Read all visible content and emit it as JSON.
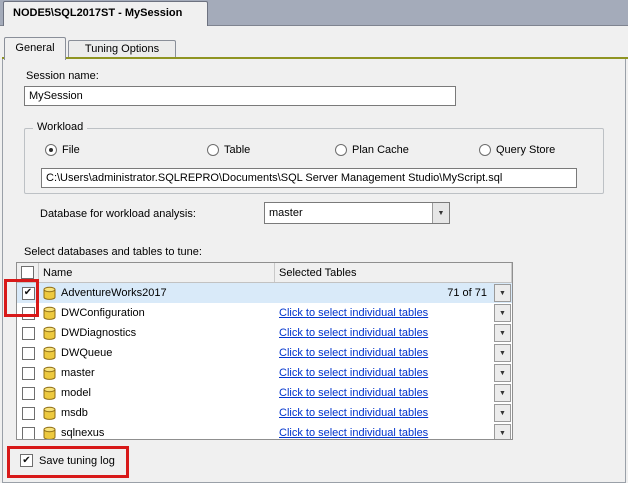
{
  "window": {
    "document_tab_label": "NODE5\\SQL2017ST - MySession"
  },
  "tabs": {
    "general": "General",
    "tuning_options": "Tuning Options"
  },
  "general_tab": {
    "session_name_label": "Session name:",
    "session_name_value": "MySession",
    "workload": {
      "group_label": "Workload",
      "options": [
        {
          "label": "File",
          "selected": true
        },
        {
          "label": "Table",
          "selected": false
        },
        {
          "label": "Plan Cache",
          "selected": false
        },
        {
          "label": "Query Store",
          "selected": false
        }
      ],
      "file_path": "C:\\Users\\administrator.SQLREPRO\\Documents\\SQL Server Management Studio\\MyScript.sql",
      "database_for_analysis_label": "Database for workload analysis:",
      "database_for_analysis_value": "master"
    },
    "databases_section": {
      "label": "Select databases and tables to tune:",
      "columns": {
        "name": "Name",
        "selected_tables": "Selected Tables"
      },
      "header_checkbox_checked": false,
      "rows": [
        {
          "name": "AdventureWorks2017",
          "checked": true,
          "selected_tables_text": "71 of 71",
          "is_link": false,
          "highlighted": true
        },
        {
          "name": "DWConfiguration",
          "checked": false,
          "selected_tables_text": "Click to select individual tables",
          "is_link": true,
          "highlighted": false
        },
        {
          "name": "DWDiagnostics",
          "checked": false,
          "selected_tables_text": "Click to select individual tables",
          "is_link": true,
          "highlighted": false
        },
        {
          "name": "DWQueue",
          "checked": false,
          "selected_tables_text": "Click to select individual tables",
          "is_link": true,
          "highlighted": false
        },
        {
          "name": "master",
          "checked": false,
          "selected_tables_text": "Click to select individual tables",
          "is_link": true,
          "highlighted": false
        },
        {
          "name": "model",
          "checked": false,
          "selected_tables_text": "Click to select individual tables",
          "is_link": true,
          "highlighted": false
        },
        {
          "name": "msdb",
          "checked": false,
          "selected_tables_text": "Click to select individual tables",
          "is_link": true,
          "highlighted": false
        },
        {
          "name": "sqlnexus",
          "checked": false,
          "selected_tables_text": "Click to select individual tables",
          "is_link": true,
          "highlighted": false
        }
      ]
    },
    "save_tuning_log": {
      "label": "Save tuning log",
      "checked": true
    }
  },
  "annotations": [
    {
      "target": "adventureworks-row-checkbox"
    },
    {
      "target": "save-tuning-log-checkbox"
    }
  ],
  "colors": {
    "link": "#0033cc",
    "row_highlight": "#d9eaf9",
    "annotation_red": "#d81919",
    "tab_underline_olive": "#8f9422",
    "doc_bar": "#a4abba"
  }
}
